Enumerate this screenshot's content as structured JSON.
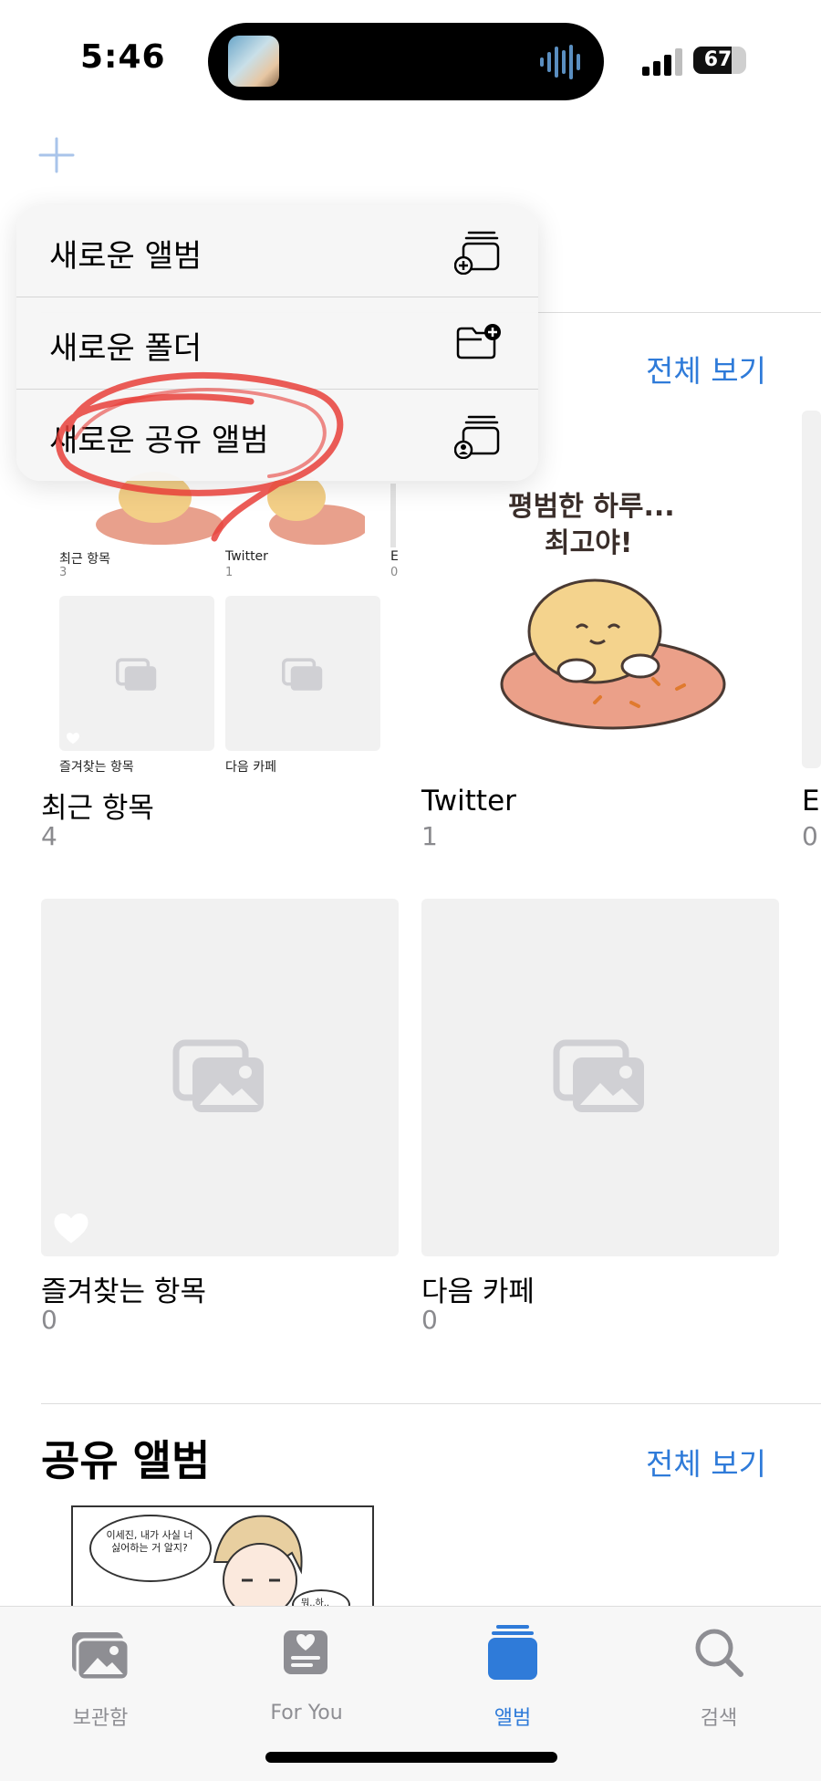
{
  "status": {
    "time": "5:46",
    "battery": "67"
  },
  "menu": {
    "items": [
      {
        "label": "새로운 앨범",
        "icon": "add-album-icon"
      },
      {
        "label": "새로운 폴더",
        "icon": "add-folder-icon"
      },
      {
        "label": "새로운 공유 앨범",
        "icon": "shared-album-icon"
      }
    ]
  },
  "my_albums": {
    "see_all": "전체 보기",
    "albums": [
      {
        "name": "최근 항목",
        "count": "4"
      },
      {
        "name": "Twitter",
        "count": "1"
      },
      {
        "name": "E",
        "count": "0"
      },
      {
        "name": "즐겨찾는 항목",
        "count": "0"
      },
      {
        "name": "다음 카페",
        "count": "0"
      }
    ],
    "mini_thumbs": [
      {
        "name": "최근 항목",
        "count": "3"
      },
      {
        "name": "Twitter",
        "count": "1"
      },
      {
        "name": "E",
        "count": "0"
      },
      {
        "name": "즐겨찾는 항목"
      },
      {
        "name": "다음 카페"
      }
    ],
    "sticker_text_line1": "평범한 하루...",
    "sticker_text_line2": "최고야!"
  },
  "shared_albums": {
    "title": "공유 앨범",
    "see_all": "전체 보기",
    "comic_bubble1": "이세진, 내가 사실 너 싫어하는 거 알지?",
    "comic_bubble2": "뭐..하.."
  },
  "tabbar": {
    "tabs": [
      {
        "label": "보관함",
        "icon": "library-icon",
        "active": false
      },
      {
        "label": "For You",
        "icon": "for-you-icon",
        "active": false
      },
      {
        "label": "앨범",
        "icon": "albums-icon",
        "active": true
      },
      {
        "label": "검색",
        "icon": "search-icon",
        "active": false
      }
    ]
  },
  "colors": {
    "accent": "#2f7bd9",
    "annotation": "#e8403a"
  }
}
